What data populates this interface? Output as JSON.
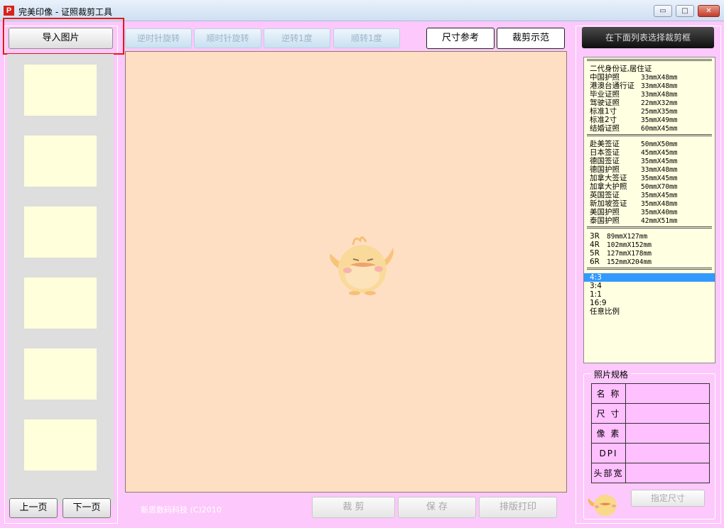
{
  "window": {
    "title": "完美印像 - 证照裁剪工具",
    "icon_letter": "P",
    "min_glyph": "▭",
    "max_glyph": "□",
    "close_glyph": "✕"
  },
  "left_panel": {
    "import_label": "导入图片",
    "prev_label": "上一页",
    "next_label": "下一页"
  },
  "toolbar": {
    "rotate_ccw_label": "逆时针旋转",
    "rotate_cw_label": "顺时针旋转",
    "rotate_ccw1_label": "逆转1度",
    "rotate_cw1_label": "顺转1度",
    "size_ref_label": "尺寸参考",
    "crop_demo_label": "裁剪示范"
  },
  "footer": {
    "copyright": "新思数码科技 (C)2010",
    "crop_label": "裁 剪",
    "save_label": "保 存",
    "layout_print_label": "排版打印"
  },
  "right_panel": {
    "hint": "在下面列表选择裁剪框",
    "groups": [
      {
        "separator": "=================================",
        "items": [
          {
            "name": "二代身份证,居住证",
            "size": ""
          },
          {
            "name": "中国护照",
            "size": "33mmX48mm"
          },
          {
            "name": "港澳台通行证",
            "size": "33mmX48mm"
          },
          {
            "name": "毕业证照",
            "size": "33mmX48mm"
          },
          {
            "name": "驾驶证照",
            "size": "22mmX32mm"
          },
          {
            "name": "标准1寸",
            "size": "25mmX35mm"
          },
          {
            "name": "标准2寸",
            "size": "35mmX49mm"
          },
          {
            "name": "结婚证照",
            "size": "60mmX45mm"
          }
        ]
      },
      {
        "separator": "=================================",
        "items": [
          {
            "name": "赴美签证",
            "size": "50mmX50mm"
          },
          {
            "name": "日本签证",
            "size": "45mmX45mm"
          },
          {
            "name": "德国签证",
            "size": "35mmX45mm"
          },
          {
            "name": "德国护照",
            "size": "33mmX48mm"
          },
          {
            "name": "加拿大签证",
            "size": "35mmX45mm"
          },
          {
            "name": "加拿大护照",
            "size": "50mmX70mm"
          },
          {
            "name": "英国签证",
            "size": "35mmX45mm"
          },
          {
            "name": "新加坡签证",
            "size": "35mmX48mm"
          },
          {
            "name": "美国护照",
            "size": "35mmX40mm"
          },
          {
            "name": "泰国护照",
            "size": "42mmX51mm"
          }
        ]
      },
      {
        "separator": "=================================",
        "items": [
          {
            "name": "3R",
            "size": "89mmX127mm"
          },
          {
            "name": "4R",
            "size": "102mmX152mm"
          },
          {
            "name": "5R",
            "size": "127mmX178mm"
          },
          {
            "name": "6R",
            "size": "152mmX204mm"
          }
        ]
      },
      {
        "separator": "=================================",
        "items": [
          {
            "name": "4:3",
            "size": "",
            "selected": true
          },
          {
            "name": "3:4",
            "size": ""
          },
          {
            "name": "1:1",
            "size": ""
          },
          {
            "name": "16:9",
            "size": ""
          },
          {
            "name": "任意比例",
            "size": ""
          }
        ]
      }
    ],
    "spec": {
      "legend": "照片规格",
      "rows": [
        "名 称",
        "尺 寸",
        "像 素",
        "DPI",
        "头部宽"
      ],
      "assign_label": "指定尺寸"
    }
  },
  "colors": {
    "background": "#fdc8fb",
    "canvas": "#ffdfc4",
    "thumb": "#ffffdc",
    "list_bg": "#ffffe1",
    "selection": "#3399ff",
    "highlight": "#e8151a"
  }
}
